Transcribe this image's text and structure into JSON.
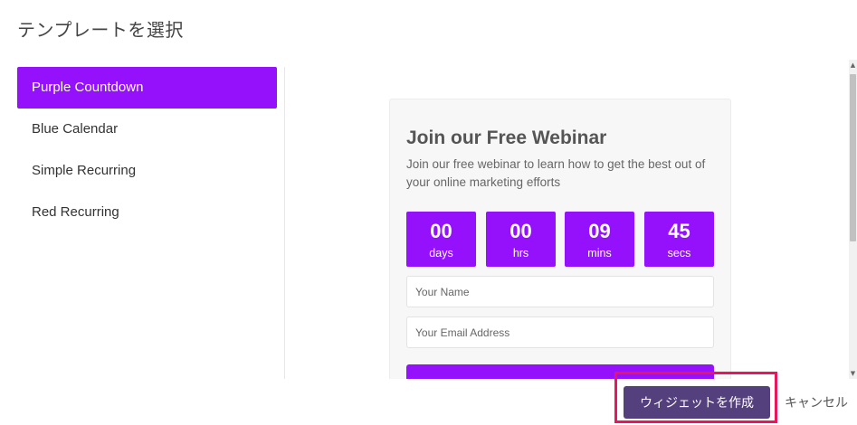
{
  "dialog": {
    "title": "テンプレートを選択"
  },
  "sidebar": {
    "items": [
      {
        "label": "Purple Countdown",
        "active": true
      },
      {
        "label": "Blue Calendar",
        "active": false
      },
      {
        "label": "Simple Recurring",
        "active": false
      },
      {
        "label": "Red Recurring",
        "active": false
      }
    ]
  },
  "preview": {
    "title": "Join our Free Webinar",
    "description": "Join our free webinar to learn how to get the best out of your online marketing efforts",
    "countdown": [
      {
        "value": "00",
        "unit": "days"
      },
      {
        "value": "00",
        "unit": "hrs"
      },
      {
        "value": "09",
        "unit": "mins"
      },
      {
        "value": "45",
        "unit": "secs"
      }
    ],
    "name_placeholder": "Your Name",
    "email_placeholder": "Your Email Address"
  },
  "footer": {
    "create_label": "ウィジェットを作成",
    "cancel_label": "キャンセル"
  },
  "colors": {
    "accent": "#9510fb",
    "create_button": "#54407d",
    "highlight": "#e8175d"
  }
}
